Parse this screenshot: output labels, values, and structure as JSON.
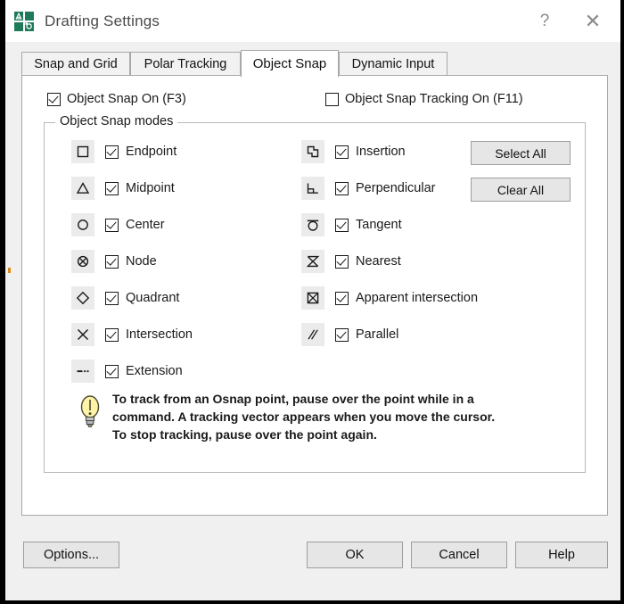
{
  "window": {
    "title": "Drafting Settings",
    "icon": "autocad-icon",
    "help_button": "?",
    "close_button": "✕"
  },
  "tabs": [
    {
      "label": "Snap and Grid",
      "active": false
    },
    {
      "label": "Polar Tracking",
      "active": false
    },
    {
      "label": "Object Snap",
      "active": true
    },
    {
      "label": "Dynamic Input",
      "active": false
    }
  ],
  "top_checkboxes": [
    {
      "label": "Object Snap On (F3)",
      "checked": true
    },
    {
      "label": "Object Snap Tracking On (F11)",
      "checked": false
    }
  ],
  "group": {
    "legend": "Object Snap modes",
    "left_column": [
      {
        "label": "Endpoint",
        "checked": true,
        "icon": "square-glyph"
      },
      {
        "label": "Midpoint",
        "checked": true,
        "icon": "triangle-glyph"
      },
      {
        "label": "Center",
        "checked": true,
        "icon": "circle-glyph"
      },
      {
        "label": "Node",
        "checked": true,
        "icon": "node-circle-x-glyph"
      },
      {
        "label": "Quadrant",
        "checked": true,
        "icon": "diamond-glyph"
      },
      {
        "label": "Intersection",
        "checked": true,
        "icon": "x-cross-glyph"
      },
      {
        "label": "Extension",
        "checked": true,
        "icon": "dash-dots-glyph"
      }
    ],
    "right_column": [
      {
        "label": "Insertion",
        "checked": true,
        "icon": "insertion-squares-glyph"
      },
      {
        "label": "Perpendicular",
        "checked": true,
        "icon": "right-angle-glyph"
      },
      {
        "label": "Tangent",
        "checked": true,
        "icon": "tangent-circle-glyph"
      },
      {
        "label": "Nearest",
        "checked": true,
        "icon": "hourglass-glyph"
      },
      {
        "label": "Apparent intersection",
        "checked": true,
        "icon": "boxed-x-glyph"
      },
      {
        "label": "Parallel",
        "checked": true,
        "icon": "parallel-lines-glyph"
      }
    ],
    "buttons": {
      "select_all": "Select All",
      "clear_all": "Clear All"
    }
  },
  "tip": {
    "icon": "lightbulb-icon",
    "line1": "To track from an Osnap point, pause over the point while in a",
    "line2": "command.  A tracking vector appears when you move the cursor.",
    "line3": "To stop tracking, pause over the point again."
  },
  "footer": {
    "options": "Options...",
    "ok": "OK",
    "cancel": "Cancel",
    "help": "Help"
  },
  "colors": {
    "window_bg": "#f0f0f0",
    "panel_bg": "#ffffff",
    "frame": "#000000",
    "button_face": "#e6e6e6",
    "glyph_bg": "#ebebeb",
    "icon_green": "#1f7a5a",
    "accent_mark": "#d98a1a"
  }
}
